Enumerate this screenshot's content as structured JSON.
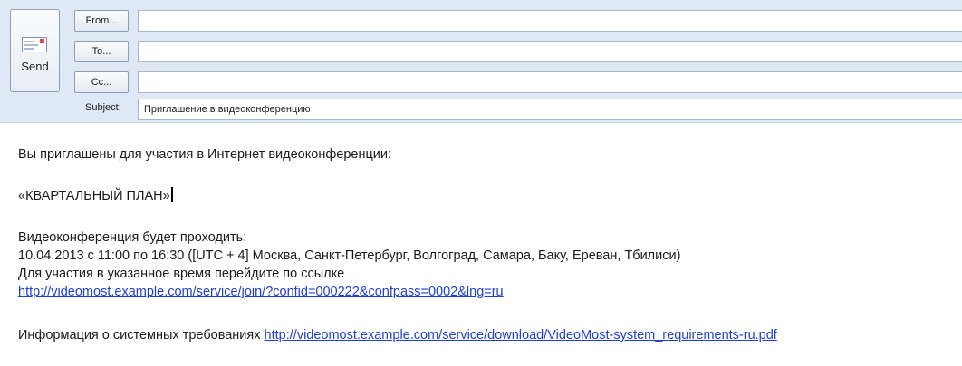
{
  "toolbar": {
    "send_label": "Send",
    "send_icon": "envelope-send-icon"
  },
  "fields": {
    "from_label": "From...",
    "to_label": "To...",
    "cc_label": "Cc...",
    "subject_label": "Subject:",
    "from_value": "",
    "to_value": "",
    "cc_value": "",
    "subject_value": "Приглашение в видеоконференцию"
  },
  "body": {
    "intro": "Вы приглашены для участия в Интернет видеоконференции:",
    "meeting_title": "«КВАРТАЛЬНЫЙ ПЛАН»",
    "schedule_heading": "Видеоконференция будет проходить:",
    "schedule_time": "10.04.2013 с 11:00 по 16:30 ([UTC + 4] Москва, Санкт-Петербург, Волгоград, Самара, Баку, Ереван, Тбилиси)",
    "join_instruction": "Для участия в указанное время перейдите по ссылке",
    "join_link": "http://videomost.example.com/service/join/?confid=000222&confpass=0002&lng=ru",
    "requirements_text": "Информация о системных требованиях ",
    "requirements_link": "http://videomost.example.com/service/download/VideoMost-system_requirements-ru.pdf"
  },
  "colors": {
    "header_bg": "#dfe9f5",
    "link": "#1f3fd1"
  }
}
